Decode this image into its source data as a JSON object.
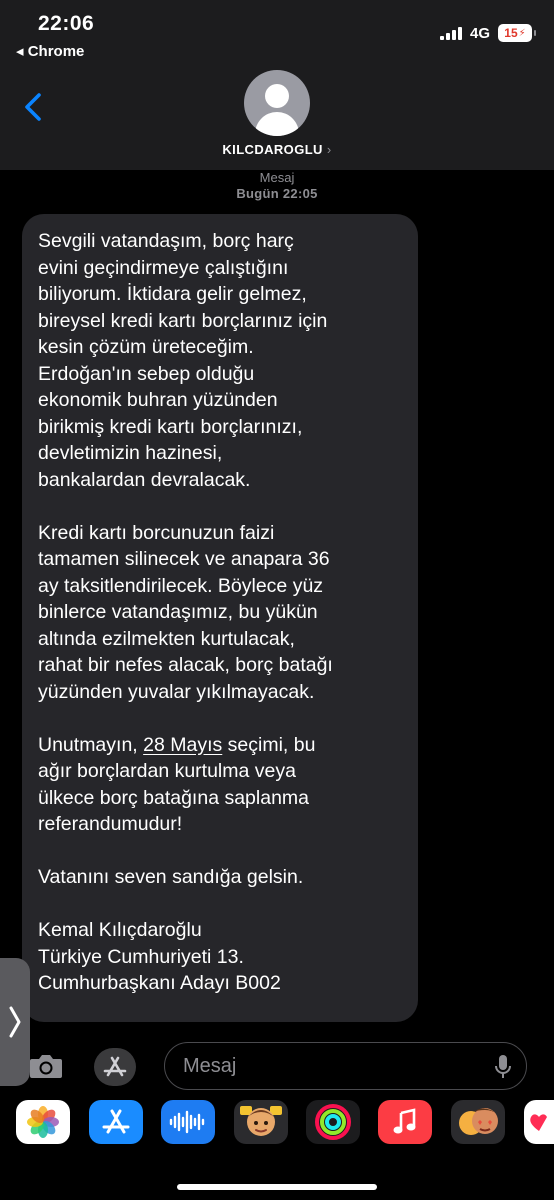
{
  "status_bar": {
    "time": "22:06",
    "back_app": "◂ Chrome",
    "network": "4G",
    "battery": "15"
  },
  "header": {
    "contact_name": "KILCDAROGLU",
    "contact_chevron": "›",
    "back_icon": "chevron-left-icon",
    "avatar_icon": "person-silhouette-icon"
  },
  "conversation": {
    "service_label": "Mesaj",
    "timestamp": "Bugün 22:05",
    "message": {
      "p1": "Sevgili vatandaşım, borç harç\nevini geçindirmeye çalıştığını\nbiliyorum. İktidara gelir gelmez,\nbireysel kredi kartı borçlarınız için\nkesin çözüm üreteceğim.\nErdoğan'ın sebep olduğu\nekonomik buhran yüzünden\nbirikmiş kredi kartı borçlarınızı,\ndevletimizin hazinesi,\nbankalardan devralacak.",
      "p2": "Kredi kartı borcunuzun faizi\ntamamen silinecek ve anapara 36\nay taksitlendirilecek. Böylece yüz\nbinlerce vatandaşımız, bu yükün\naltında ezilmekten kurtulacak,\nrahat bir nefes alacak, borç batağı\nyüzünden yuvalar yıkılmayacak.",
      "p3_before": "Unutmayın, ",
      "p3_link": "28 Mayıs",
      "p3_after": " seçimi, bu\nağır borçlardan kurtulma veya\nülkece borç batağına saplanma\nreferandumudur!",
      "p4": "Vatanını seven sandığa gelsin.",
      "p5": "Kemal Kılıçdaroğlu\nTürkiye Cumhuriyeti 13.\nCumhurbaşkanı Adayı B002"
    }
  },
  "composer": {
    "placeholder": "Mesaj",
    "camera_icon": "camera-icon",
    "apps_icon": "app-store-icon",
    "mic_icon": "microphone-icon"
  },
  "app_strip": {
    "apps": [
      "photos",
      "app-store",
      "audio-message",
      "memoji",
      "activity",
      "music",
      "memoji-stickers",
      "digital-touch"
    ]
  },
  "colors": {
    "accent_blue": "#0a84ff",
    "bubble_gray": "#26262a",
    "header_bg": "#1c1c1e"
  }
}
